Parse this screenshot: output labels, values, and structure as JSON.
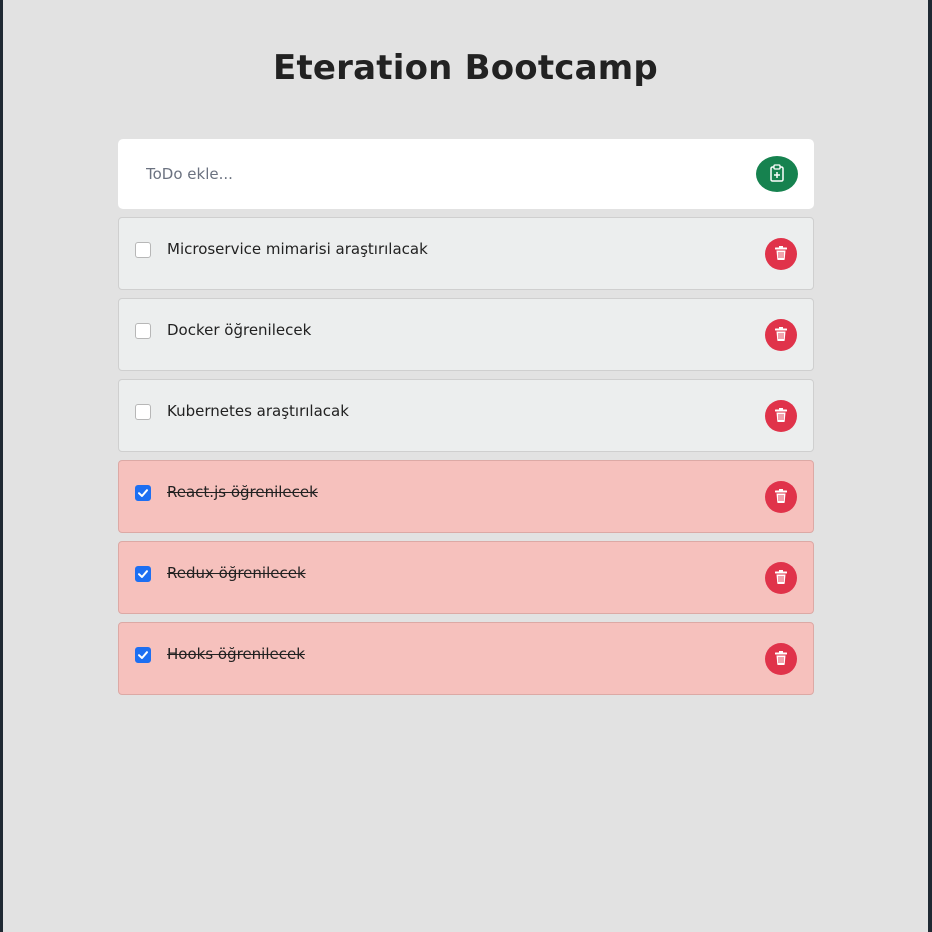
{
  "title": "Eteration Bootcamp",
  "input": {
    "placeholder": "ToDo ekle...",
    "value": ""
  },
  "todos": [
    {
      "text": "Microservice mimarisi araştırılacak",
      "done": false
    },
    {
      "text": "Docker öğrenilecek",
      "done": false
    },
    {
      "text": "Kubernetes araştırılacak",
      "done": false
    },
    {
      "text": "React.js öğrenilecek",
      "done": true
    },
    {
      "text": "Redux öğrenilecek",
      "done": true
    },
    {
      "text": "Hooks öğrenilecek",
      "done": true
    }
  ],
  "icons": {
    "add": "clipboard-plus-icon",
    "delete": "trash-icon",
    "check": "check-icon"
  },
  "colors": {
    "add_button": "#16824f",
    "delete_button": "#e0334a",
    "done_row": "#f6c1bd",
    "open_row": "#eceeee",
    "checkbox_checked": "#1d6ff2"
  }
}
